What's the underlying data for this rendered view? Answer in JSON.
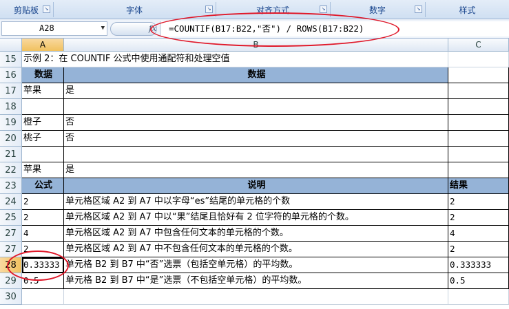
{
  "ribbon": {
    "groups": [
      {
        "label": "剪贴板"
      },
      {
        "label": "字体"
      },
      {
        "label": "对齐方式"
      },
      {
        "label": "数字"
      },
      {
        "label": "样式"
      }
    ]
  },
  "formula_bar": {
    "name_box": "A28",
    "fx_label": "fx",
    "formula": "=COUNTIF(B17:B22,\"否\") / ROWS(B17:B22)"
  },
  "columns": [
    {
      "label": "A",
      "selected": true
    },
    {
      "label": "B",
      "selected": false
    },
    {
      "label": "C",
      "selected": false
    }
  ],
  "rows": [
    {
      "num": "15",
      "a": "示例 2：在 COUNTIF 公式中使用通配符和处理空值",
      "b": "",
      "c": ""
    },
    {
      "num": "16",
      "a": "数据",
      "b": "数据",
      "c": ""
    },
    {
      "num": "17",
      "a": "苹果",
      "b": "是",
      "c": ""
    },
    {
      "num": "18",
      "a": "",
      "b": "",
      "c": ""
    },
    {
      "num": "19",
      "a": "橙子",
      "b": "否",
      "c": ""
    },
    {
      "num": "20",
      "a": "桃子",
      "b": "否",
      "c": ""
    },
    {
      "num": "21",
      "a": "",
      "b": "",
      "c": ""
    },
    {
      "num": "22",
      "a": "苹果",
      "b": "是",
      "c": ""
    },
    {
      "num": "23",
      "a": "公式",
      "b": "说明",
      "c": "结果"
    },
    {
      "num": "24",
      "a": "2",
      "b": "单元格区域 A2 到 A7 中以字母“es”结尾的单元格的个数",
      "c": "2"
    },
    {
      "num": "25",
      "a": "2",
      "b": "单元格区域 A2 到 A7 中以“果”结尾且恰好有 2 位字符的单元格的个数。",
      "c": "2"
    },
    {
      "num": "27",
      "a": "4",
      "b": "单元格区域 A2 到 A7 中包含任何文本的单元格的个数。",
      "c": "4"
    },
    {
      "num": "27",
      "a": "2",
      "b": "单元格区域 A2 到 A7 中不包含任何文本的单元格的个数。",
      "c": "2"
    },
    {
      "num": "28",
      "a": "0.33333",
      "b": "单元格 B2 到 B7 中“否”选票（包括空单元格）的平均数。",
      "c": "0.333333"
    },
    {
      "num": "29",
      "a": "0.5",
      "b": "单元格 B2 到 B7 中“是”选票（不包括空单元格）的平均数。",
      "c": "0.5"
    },
    {
      "num": "30",
      "a": "",
      "b": "",
      "c": ""
    }
  ],
  "colors": {
    "header_fill": "#95b3d7",
    "annotation_red": "#e0192a",
    "selected_header": "#f1c15f"
  }
}
